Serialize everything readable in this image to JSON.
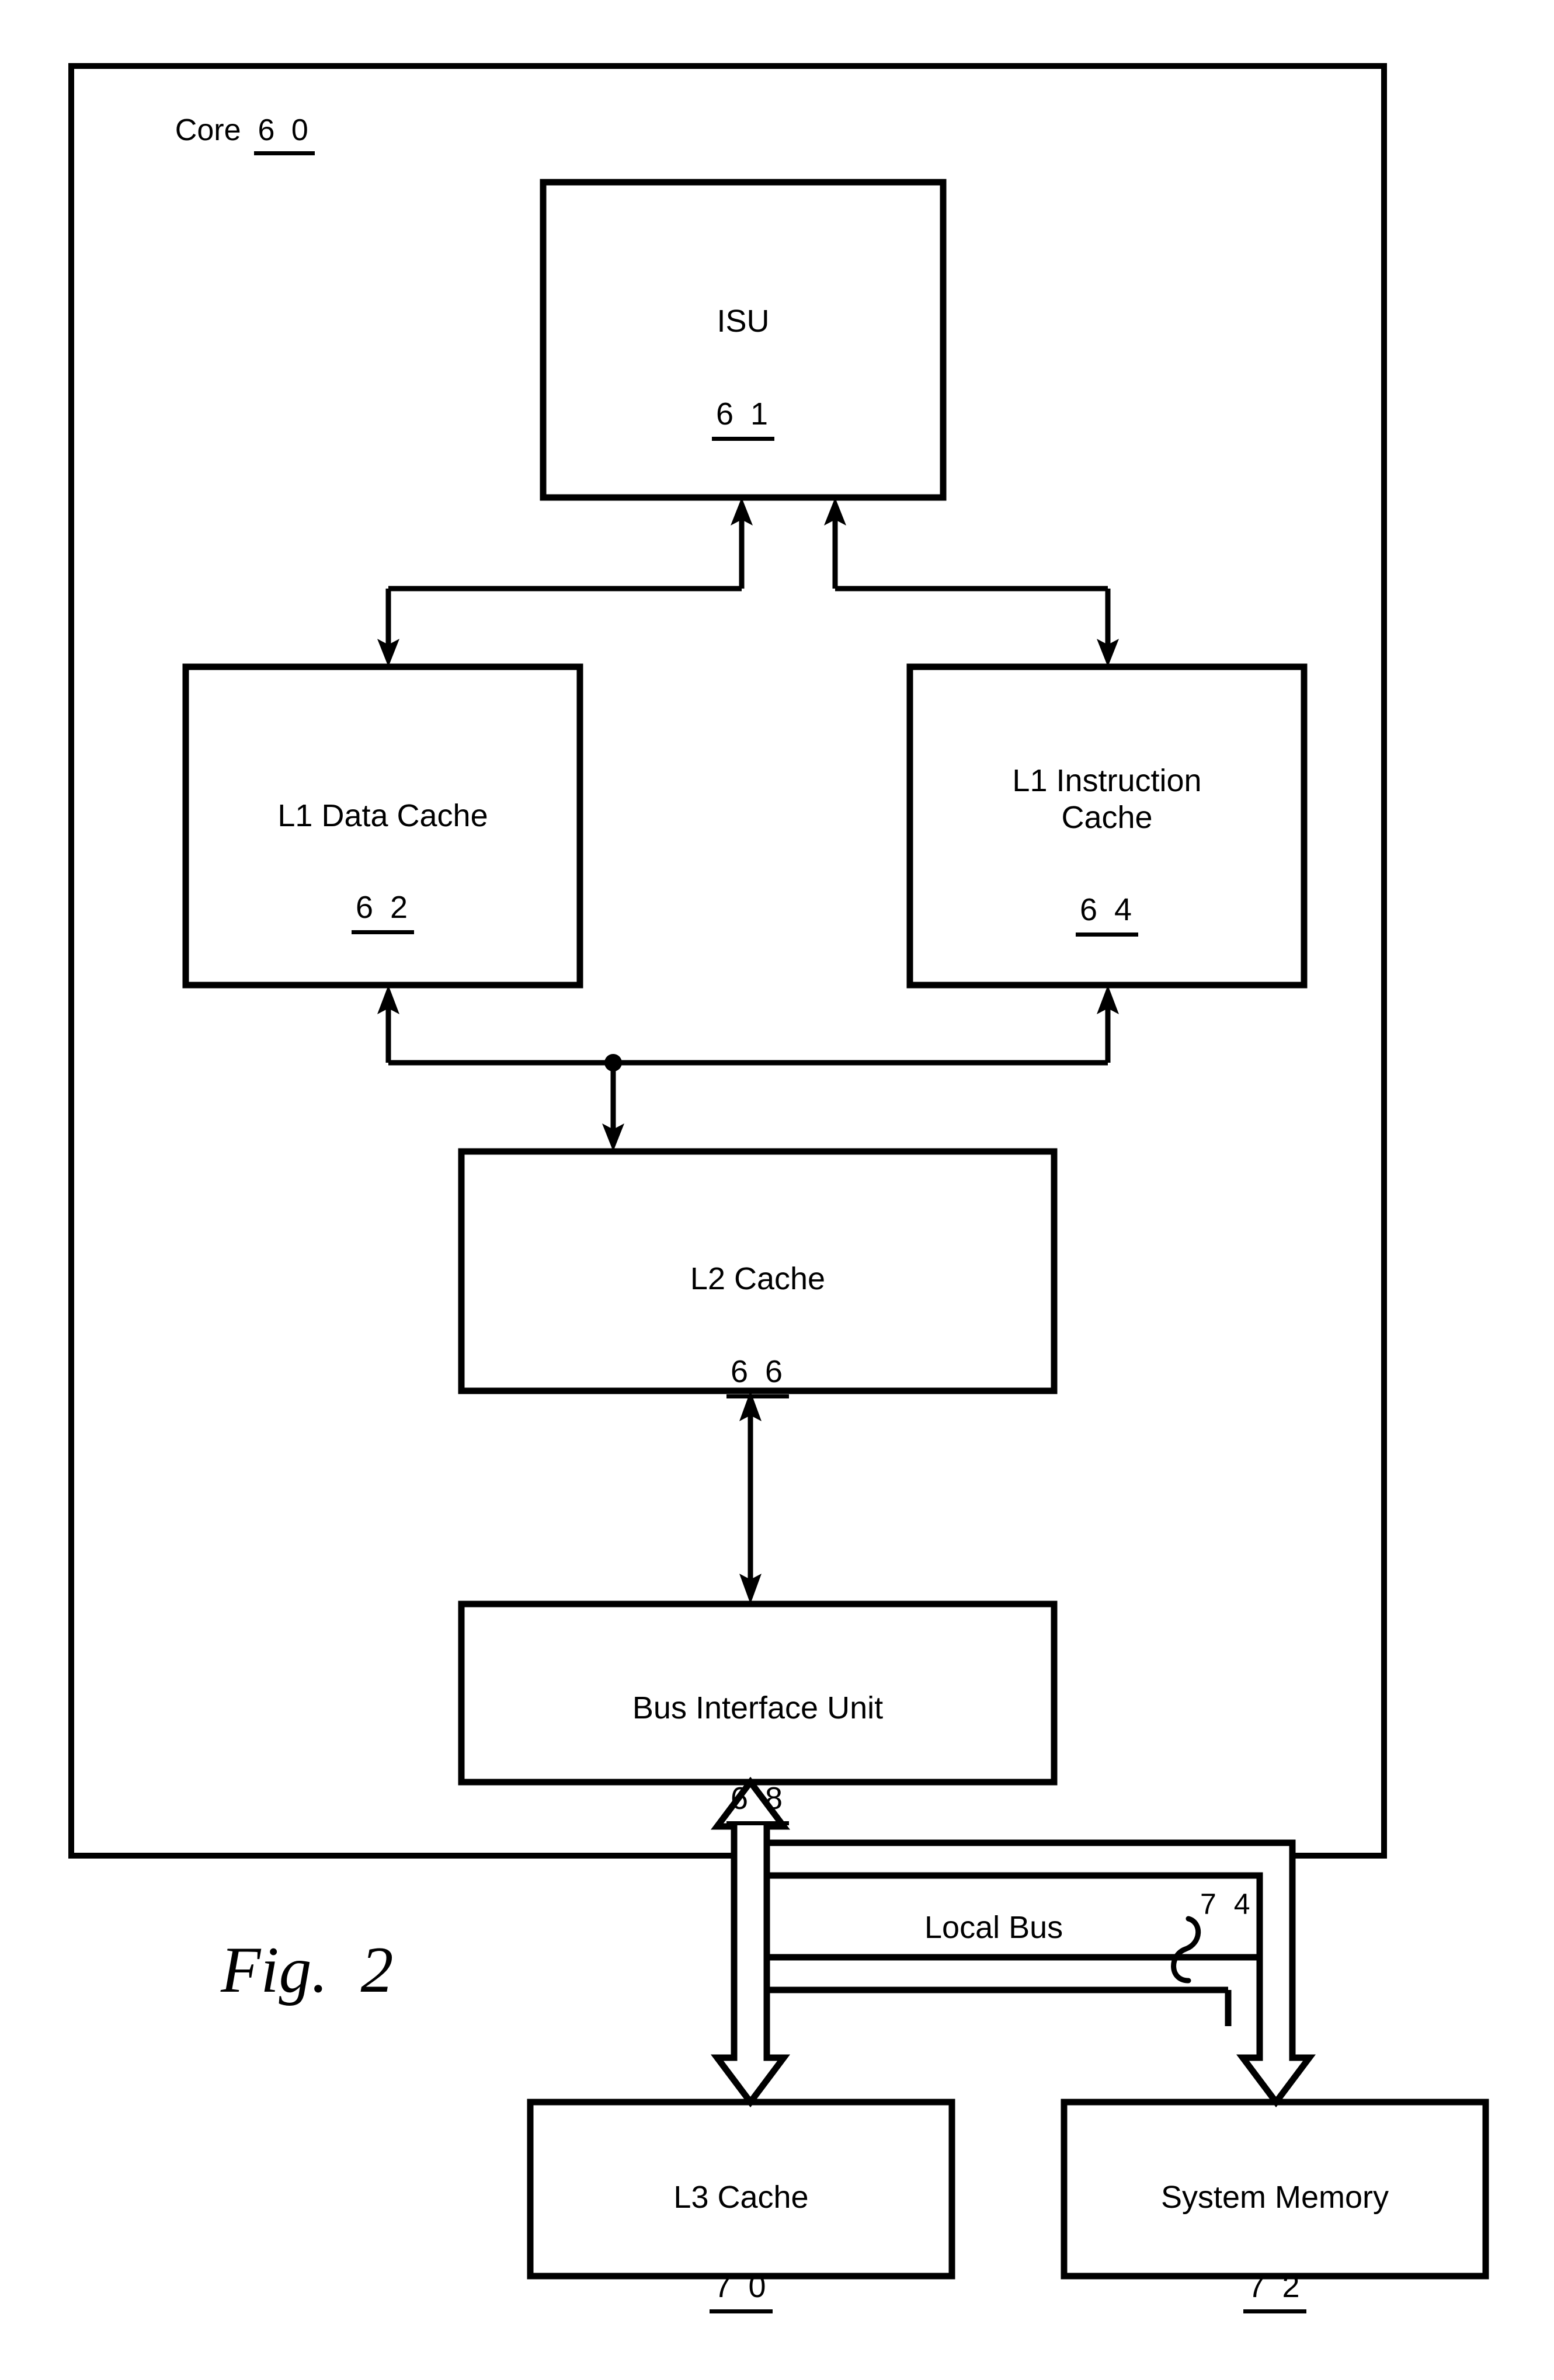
{
  "figure": {
    "caption": "Fig.  2",
    "outer_block": {
      "label": "Core",
      "ref": "6 0"
    },
    "blocks": [
      {
        "id": "isu",
        "label": "ISU",
        "ref": "6 1"
      },
      {
        "id": "l1_data_cache",
        "label": "L1 Data Cache",
        "ref": "6 2"
      },
      {
        "id": "l1_instr_cache",
        "label": "L1 Instruction\nCache",
        "ref": "6 4"
      },
      {
        "id": "l2_cache",
        "label": "L2 Cache",
        "ref": "6 6"
      },
      {
        "id": "bus_interface",
        "label": "Bus Interface Unit",
        "ref": "6 8"
      },
      {
        "id": "l3_cache",
        "label": "L3 Cache",
        "ref": "7 0"
      },
      {
        "id": "system_memory",
        "label": "System Memory",
        "ref": "7 2"
      }
    ],
    "bus": {
      "label": "Local Bus",
      "ref": "7 4"
    },
    "colors": {
      "ink": "#000000",
      "paper": "#ffffff"
    }
  }
}
